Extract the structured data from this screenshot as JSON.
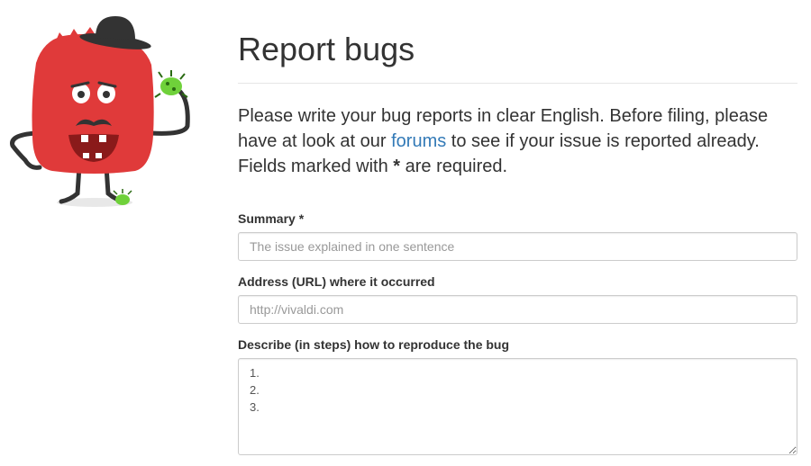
{
  "header": {
    "title": "Report bugs"
  },
  "intro": {
    "before_link": "Please write your bug reports in clear English. Before filing, please have at look at our ",
    "link_text": "forums",
    "after_link": " to see if your issue is reported already. Fields marked with ",
    "required_marker": "*",
    "end": " are required."
  },
  "form": {
    "summary": {
      "label": "Summary *",
      "placeholder": "The issue explained in one sentence",
      "value": ""
    },
    "address": {
      "label": "Address (URL) where it occurred",
      "placeholder": "http://vivaldi.com",
      "value": ""
    },
    "steps": {
      "label": "Describe (in steps) how to reproduce the bug",
      "value": "1.\n2.\n3."
    }
  },
  "colors": {
    "link": "#337ab7",
    "mascot_body": "#e03a3a",
    "bug_green": "#6fd13a"
  },
  "icons": {
    "mascot": "bug-monster-mascot-icon"
  }
}
